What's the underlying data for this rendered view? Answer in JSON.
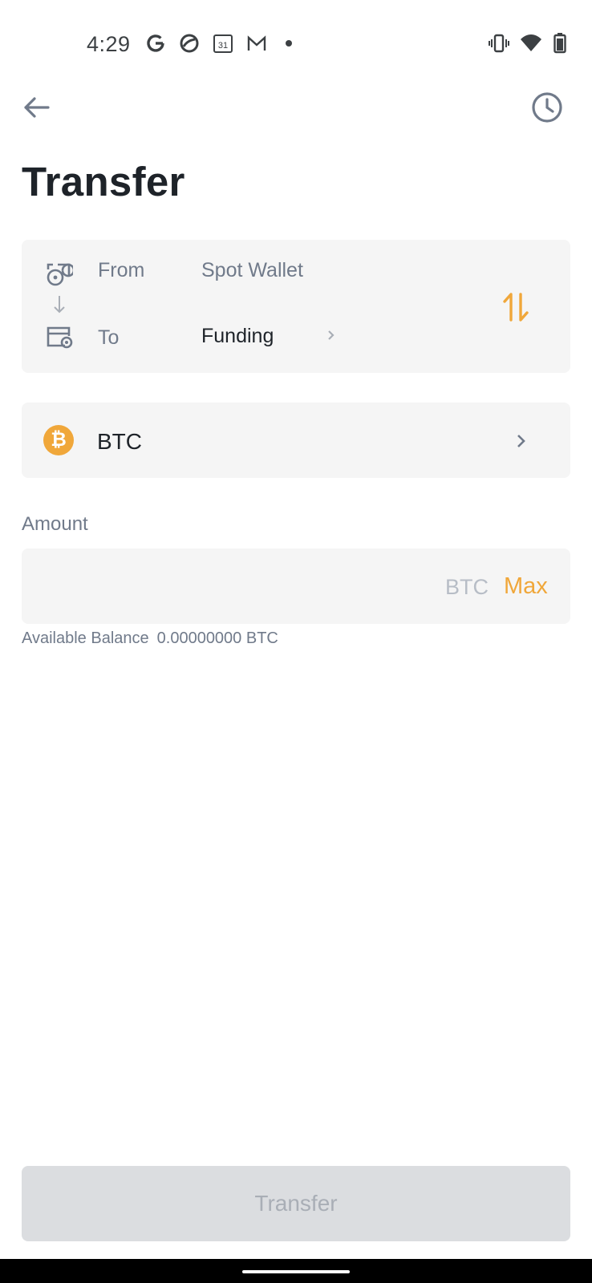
{
  "status_bar": {
    "time": "4:29",
    "calendar_day": "31",
    "icons": [
      "google-icon",
      "sync-icon",
      "calendar-icon",
      "gmail-icon",
      "notification-dot-icon",
      "vibrate-icon",
      "wifi-icon",
      "battery-icon"
    ]
  },
  "header": {
    "title": "Transfer"
  },
  "wallets": {
    "from_label": "From",
    "from_value": "Spot Wallet",
    "to_label": "To",
    "to_value": "Funding"
  },
  "coin": {
    "symbol": "BTC",
    "icon_glyph": "₿",
    "icon_color": "#f0a73a"
  },
  "amount": {
    "label": "Amount",
    "value": "",
    "unit": "BTC",
    "max_label": "Max"
  },
  "balance": {
    "label": "Available Balance",
    "value": "0.00000000 BTC"
  },
  "actions": {
    "transfer_label": "Transfer"
  },
  "colors": {
    "accent": "#f0a73a",
    "card_bg": "#f5f5f5",
    "text_primary": "#1e2329",
    "text_secondary": "#707a8a",
    "button_disabled_bg": "#dbdde0",
    "button_disabled_text": "#a9aeb6"
  }
}
